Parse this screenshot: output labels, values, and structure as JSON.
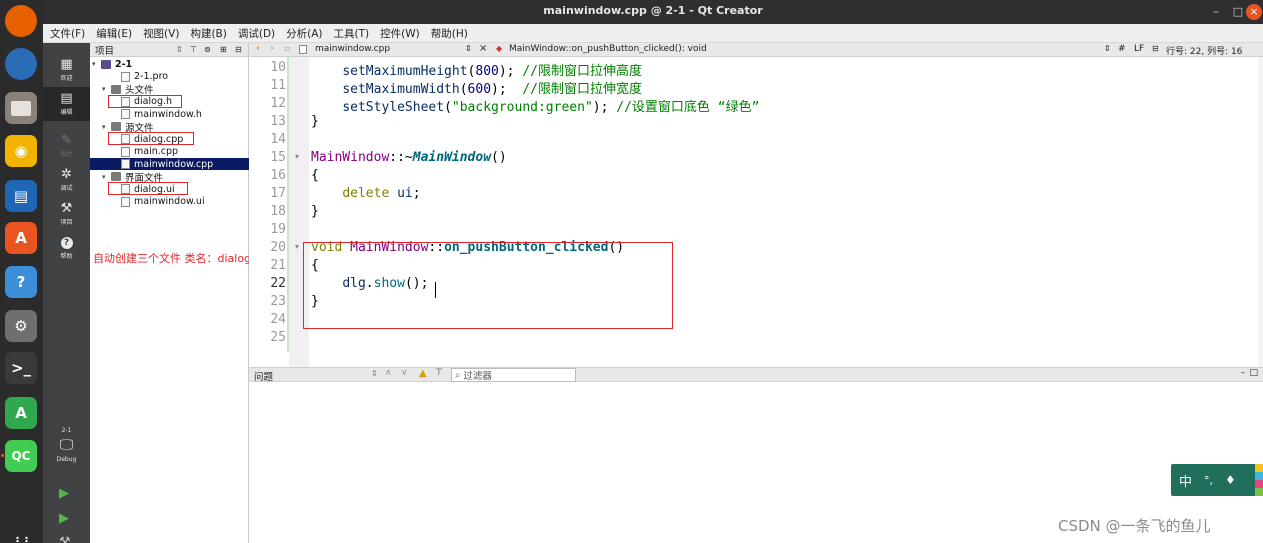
{
  "window": {
    "title": "mainwindow.cpp @ 2-1 - Qt Creator",
    "controls": {
      "minimize": "–",
      "maximize": "□",
      "close": "×"
    }
  },
  "menu": [
    "文件(F)",
    "编辑(E)",
    "视图(V)",
    "构建(B)",
    "调试(D)",
    "分析(A)",
    "工具(T)",
    "控件(W)",
    "帮助(H)"
  ],
  "dock": {
    "apps": [
      {
        "name": "firefox-icon",
        "glyph": "",
        "color": "#e66000"
      },
      {
        "name": "thunderbird-icon",
        "glyph": "",
        "color": "#2a6cb6"
      },
      {
        "name": "files-icon",
        "glyph": "",
        "color": "#8a8278"
      },
      {
        "name": "rhythmbox-icon",
        "glyph": "◉",
        "color": "#f2b400"
      },
      {
        "name": "writer-icon",
        "glyph": "▤",
        "color": "#1f67b4"
      },
      {
        "name": "software-icon",
        "glyph": "A",
        "color": "#e95420"
      },
      {
        "name": "help-icon",
        "glyph": "?",
        "color": "#3b8fd8"
      },
      {
        "name": "settings-icon",
        "glyph": "⚙",
        "color": "#6f6f6f"
      },
      {
        "name": "terminal-icon",
        "glyph": ">_",
        "color": "#3a3a3a"
      },
      {
        "name": "android-studio-icon",
        "glyph": "A",
        "color": "#2fa84f"
      },
      {
        "name": "qt-creator-icon",
        "glyph": "QC",
        "color": "#41cd52"
      },
      {
        "name": "apps-grid-icon",
        "glyph": "⋮⋮",
        "color": "#2b2b2b"
      }
    ]
  },
  "modes": {
    "items": [
      {
        "label": "欢迎",
        "icon": "grid-icon",
        "state": "normal"
      },
      {
        "label": "编辑",
        "icon": "edit-icon",
        "state": "active"
      },
      {
        "label": "设计",
        "icon": "pencil-icon",
        "state": "disabled"
      },
      {
        "label": "调试",
        "icon": "bug-icon",
        "state": "normal"
      },
      {
        "label": "项目",
        "icon": "wrench-icon",
        "state": "normal"
      },
      {
        "label": "帮助",
        "icon": "help-icon",
        "state": "normal"
      }
    ],
    "target": {
      "project": "2-1",
      "config": "Debug"
    }
  },
  "project_panel": {
    "header": "项目",
    "tree": [
      {
        "label": "2-1",
        "kind": "project",
        "indent": 0
      },
      {
        "label": "2-1.pro",
        "kind": "file",
        "indent": 2
      },
      {
        "label": "头文件",
        "kind": "folder",
        "indent": 1
      },
      {
        "label": "dialog.h",
        "kind": "file",
        "indent": 2,
        "boxed": true
      },
      {
        "label": "mainwindow.h",
        "kind": "file",
        "indent": 2
      },
      {
        "label": "源文件",
        "kind": "folder",
        "indent": 1
      },
      {
        "label": "dialog.cpp",
        "kind": "file",
        "indent": 2,
        "boxed": true
      },
      {
        "label": "main.cpp",
        "kind": "file",
        "indent": 2
      },
      {
        "label": "mainwindow.cpp",
        "kind": "file",
        "indent": 2,
        "selected": true
      },
      {
        "label": "界面文件",
        "kind": "folder",
        "indent": 1
      },
      {
        "label": "dialog.ui",
        "kind": "file",
        "indent": 2,
        "boxed": true
      },
      {
        "label": "mainwindow.ui",
        "kind": "file",
        "indent": 2
      }
    ],
    "annotation": "自动创建三个文件 类名：dialog"
  },
  "editor": {
    "file_tab": "mainwindow.cpp",
    "function_combo": "MainWindow::on_pushButton_clicked(): void",
    "status": {
      "hash": "#",
      "line_ending": "LF",
      "position": "行号: 22, 列号: 16"
    },
    "lines": [
      {
        "n": "10",
        "html": "    <span class='mem'>setMaximumHeight</span>(<span class='num'>800</span>); <span class='cmt'>//限制窗口拉伸高度</span>"
      },
      {
        "n": "11",
        "html": "    <span class='mem'>setMaximumWidth</span>(<span class='num'>600</span>);  <span class='cmt'>//限制窗口拉伸宽度</span>"
      },
      {
        "n": "12",
        "html": "    <span class='mem'>setStyleSheet</span>(<span class='str'>\"background:green\"</span>); <span class='cmt'>//设置窗口底色 “绿色”</span>"
      },
      {
        "n": "13",
        "html": "}"
      },
      {
        "n": "14",
        "html": ""
      },
      {
        "n": "15",
        "html": "<span class='cls'>MainWindow</span>::~<span class='bold-fn'>MainWindow</span>()"
      },
      {
        "n": "16",
        "html": "{"
      },
      {
        "n": "17",
        "html": "    <span class='kw'>delete</span> <span class='mem'>ui</span>;"
      },
      {
        "n": "18",
        "html": "}"
      },
      {
        "n": "19",
        "html": ""
      },
      {
        "n": "20",
        "html": "<span class='kw'>void</span> <span class='cls'>MainWindow</span>::<span class='bold2'>on_pushButton_clicked</span>()"
      },
      {
        "n": "21",
        "html": "{"
      },
      {
        "n": "22",
        "html": "    <span class='mem'>dlg</span>.<span class='fn'>show</span>();"
      },
      {
        "n": "23",
        "html": "}"
      },
      {
        "n": "24",
        "html": ""
      },
      {
        "n": "25",
        "html": ""
      }
    ]
  },
  "issues": {
    "title": "问题",
    "filter_placeholder": "过滤器"
  },
  "ime": {
    "label": "中",
    "extra": "°,"
  },
  "watermark": "CSDN @一条飞的鱼儿"
}
